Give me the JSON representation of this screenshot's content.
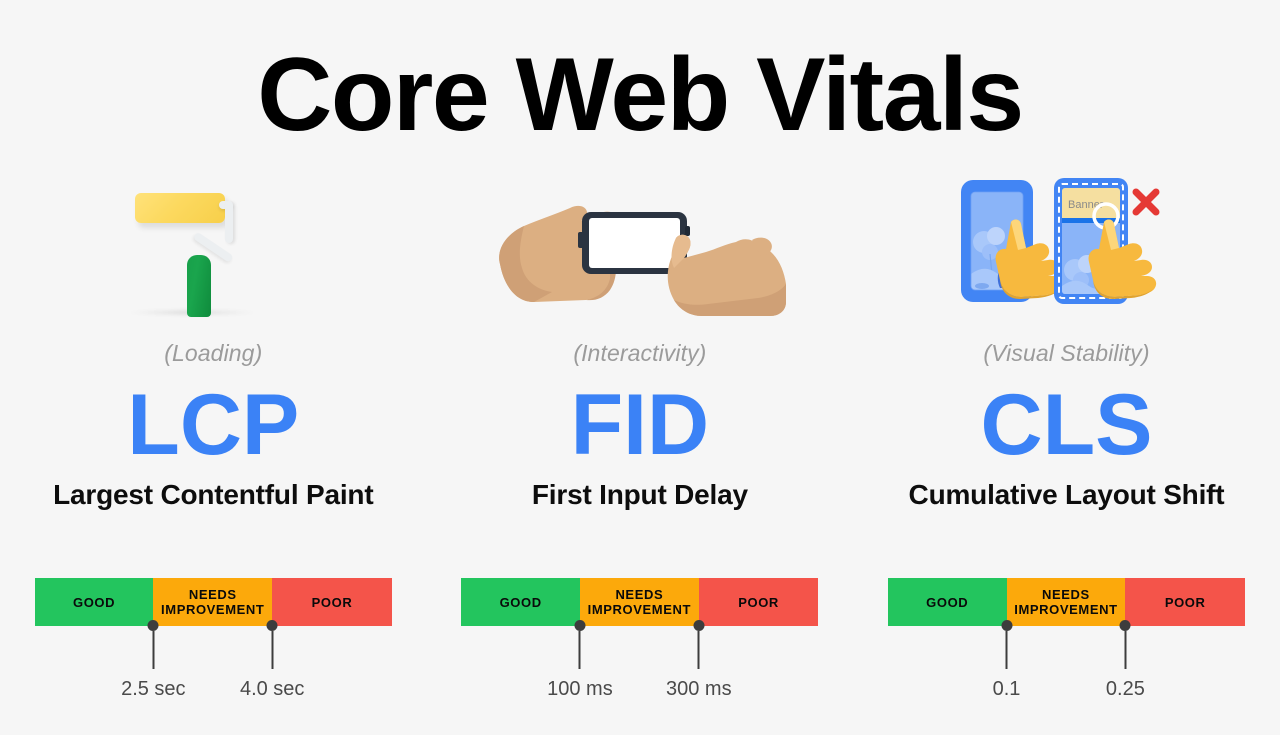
{
  "page": {
    "title": "Core Web Vitals",
    "background_color": "#f6f6f6",
    "accent_blue": "#3b82f6"
  },
  "metrics": [
    {
      "aspect": "(Loading)",
      "acronym": "LCP",
      "name": "Largest Contentful Paint",
      "icon": "paint-roller-icon",
      "scale": {
        "segments": [
          {
            "label": "GOOD",
            "color": "#23c55e"
          },
          {
            "label": "NEEDS\nIMPROVEMENT",
            "label_line1": "NEEDS",
            "label_line2": "IMPROVEMENT",
            "color": "#fca90b"
          },
          {
            "label": "POOR",
            "color": "#f4544a"
          }
        ],
        "thresholds": [
          {
            "value": "2.5 sec",
            "position_pct": 33.2
          },
          {
            "value": "4.0 sec",
            "position_pct": 66.5
          }
        ]
      }
    },
    {
      "aspect": "(Interactivity)",
      "acronym": "FID",
      "name": "First Input Delay",
      "icon": "hands-holding-phone-tap-icon",
      "scale": {
        "segments": [
          {
            "label": "GOOD",
            "color": "#23c55e"
          },
          {
            "label": "NEEDS\nIMPROVEMENT",
            "label_line1": "NEEDS",
            "label_line2": "IMPROVEMENT",
            "color": "#fca90b"
          },
          {
            "label": "POOR",
            "color": "#f4544a"
          }
        ],
        "thresholds": [
          {
            "value": "100 ms",
            "position_pct": 33.2
          },
          {
            "value": "300 ms",
            "position_pct": 66.5
          }
        ]
      }
    },
    {
      "aspect": "(Visual Stability)",
      "acronym": "CLS",
      "name": "Cumulative Layout Shift",
      "icon": "phone-layout-shift-banner-icon",
      "icon_labels": {
        "banner": "Banner",
        "error_mark": "✕"
      },
      "scale": {
        "segments": [
          {
            "label": "GOOD",
            "color": "#23c55e"
          },
          {
            "label": "NEEDS\nIMPROVEMENT",
            "label_line1": "NEEDS",
            "label_line2": "IMPROVEMENT",
            "color": "#fca90b"
          },
          {
            "label": "POOR",
            "color": "#f4544a"
          }
        ],
        "thresholds": [
          {
            "value": "0.1",
            "position_pct": 33.2
          },
          {
            "value": "0.25",
            "position_pct": 66.5
          }
        ]
      }
    }
  ]
}
